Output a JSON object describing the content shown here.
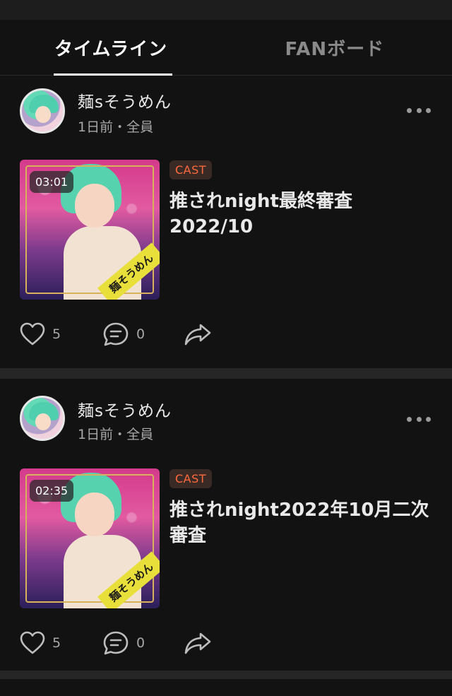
{
  "tabs": [
    {
      "label": "タイムライン",
      "active": true
    },
    {
      "label": "FANボード",
      "active": false
    }
  ],
  "posts": [
    {
      "user": "麺sそうめん",
      "meta": "1日前・全員",
      "duration": "03:01",
      "badge": "CAST",
      "title": "推されnight最終審査\n2022/10",
      "likes": "5",
      "comments": "0",
      "thumb_caption": "麺そうめん"
    },
    {
      "user": "麺sそうめん",
      "meta": "1日前・全員",
      "duration": "02:35",
      "badge": "CAST",
      "title": "推されnight2022年10月二次\n審査",
      "likes": "5",
      "comments": "0",
      "thumb_caption": "麺そうめん"
    }
  ],
  "colors": {
    "background": "#121212",
    "badge_text": "#ff6a3d",
    "active_tab": "#ffffff",
    "inactive_tab": "#8a8a8a"
  },
  "icons": [
    "heart-icon",
    "comment-icon",
    "share-icon",
    "more-icon"
  ]
}
